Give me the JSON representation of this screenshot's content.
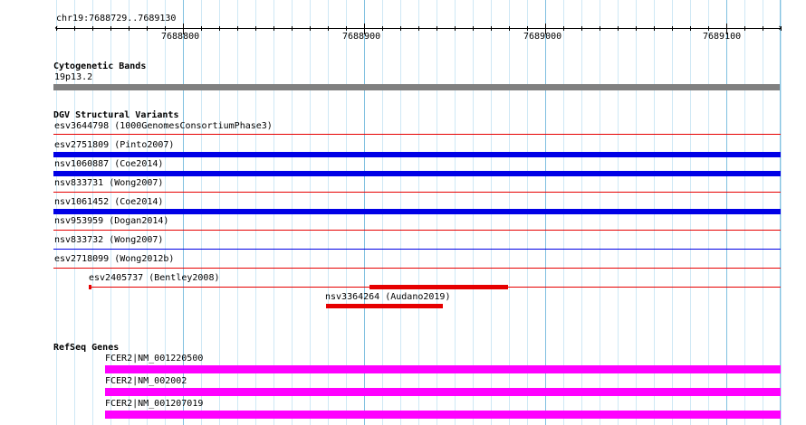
{
  "ruler": {
    "location": "chr19:7688729..7689130",
    "start": 7688729,
    "end": 7689130,
    "labels": [
      "7688800",
      "7688900",
      "7689000",
      "7689100"
    ]
  },
  "colors": {
    "grid_major": "#80c0e0",
    "grid_minor": "#cfe8f5",
    "band": "#808080",
    "variant_gain": "#0000e6",
    "variant_loss": "#e60000",
    "variant_line": "#e60000",
    "gene": "#ff00ff"
  },
  "tracks": {
    "cytobands": {
      "title": "Cytogenetic Bands",
      "band": {
        "label": "19p13.2",
        "start": 7688729,
        "end": 7689130
      }
    },
    "dgv": {
      "title": "DGV Structural Variants",
      "rows": [
        {
          "label": "esv3644798  (1000GenomesConsortiumPhase3)",
          "type": "line",
          "line_color": "#e60000"
        },
        {
          "label": "esv2751809  (Pinto2007)",
          "type": "gain",
          "start": 7688729,
          "end": 7689130
        },
        {
          "label": "nsv1060887  (Coe2014)",
          "type": "gain",
          "start": 7688729,
          "end": 7689130
        },
        {
          "label": "nsv833731  (Wong2007)",
          "type": "line",
          "line_color": "#e60000"
        },
        {
          "label": "nsv1061452  (Coe2014)",
          "type": "gain",
          "start": 7688729,
          "end": 7689130
        },
        {
          "label": "nsv953959  (Dogan2014)",
          "type": "line",
          "line_color": "#e60000"
        },
        {
          "label": "nsv833732  (Wong2007)",
          "type": "line",
          "line_color": "#0000e6"
        },
        {
          "label": "esv2718099  (Wong2012b)",
          "type": "line",
          "line_color": "#e60000"
        }
      ],
      "esv2405737": {
        "label": "esv2405737  (Bentley2008)",
        "start": 7688749,
        "end": 7689130,
        "blocks": [
          {
            "start": 7688749,
            "end": 7688751
          },
          {
            "start": 7688903,
            "end": 7688979
          }
        ]
      },
      "nsv3364264": {
        "label": "nsv3364264  (Audano2019)",
        "start": 7688879,
        "end": 7688943
      }
    },
    "refseq": {
      "title": "RefSeq Genes",
      "genes": [
        {
          "label": "FCER2|NM_001220500",
          "start": 7688757,
          "end": 7689130
        },
        {
          "label": "FCER2|NM_002002",
          "start": 7688757,
          "end": 7689130
        },
        {
          "label": "FCER2|NM_001207019",
          "start": 7688757,
          "end": 7689130
        }
      ]
    }
  }
}
